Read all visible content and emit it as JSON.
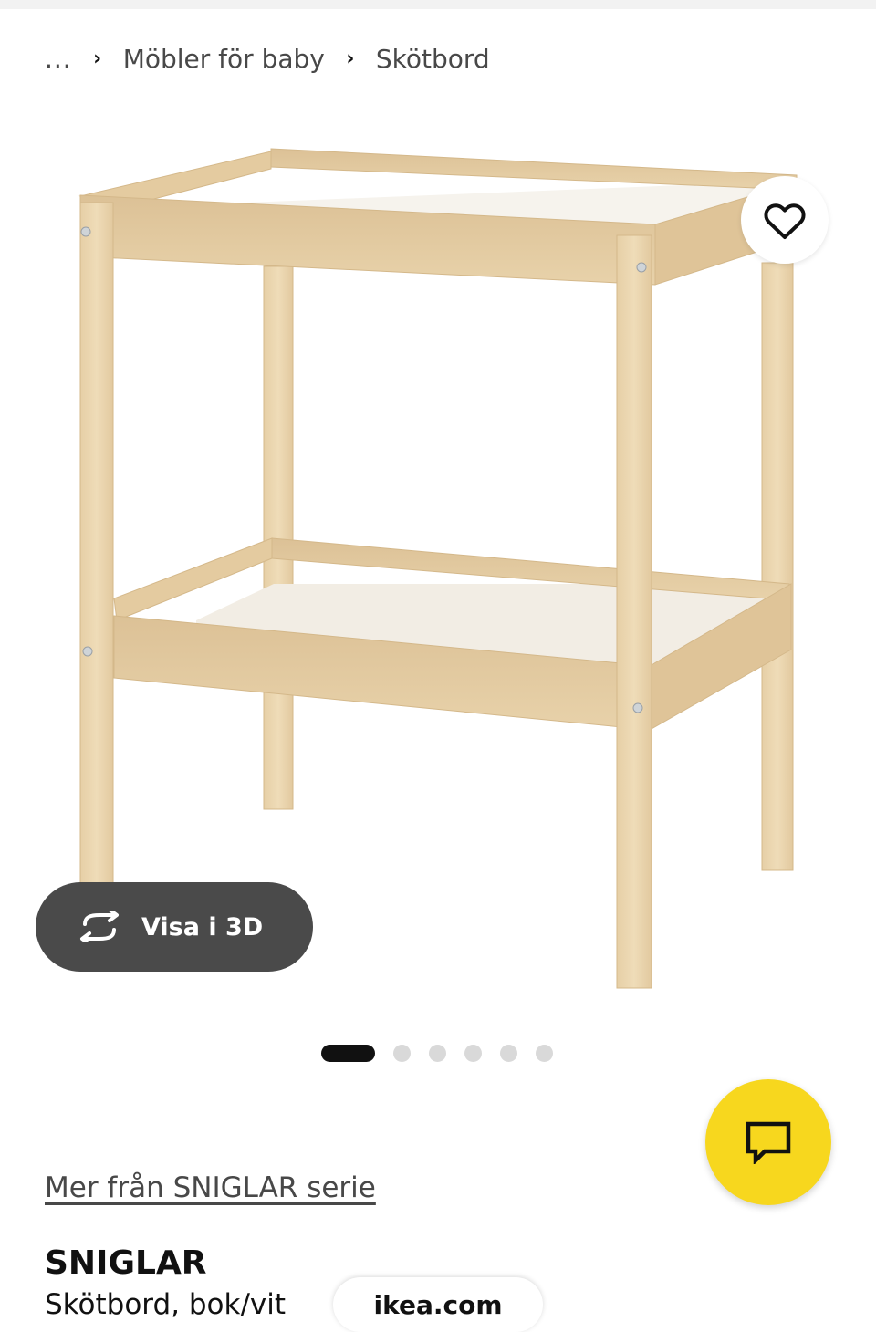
{
  "breadcrumb": {
    "ellipsis": "...",
    "items": [
      "Möbler för baby",
      "Skötbord"
    ]
  },
  "image": {
    "alt": "SNIGLAR skötbord"
  },
  "favorite": {
    "icon": "heart-icon"
  },
  "view3d": {
    "label": "Visa i 3D",
    "icon": "rotate-3d-icon"
  },
  "carousel": {
    "total": 6,
    "active": 1
  },
  "chat": {
    "icon": "chat-icon",
    "color": "#f7d71e"
  },
  "product": {
    "series_link": "Mer från SNIGLAR serie",
    "name": "SNIGLAR",
    "description": "Skötbord, bok/vit"
  },
  "browser": {
    "url": "ikea.com"
  }
}
